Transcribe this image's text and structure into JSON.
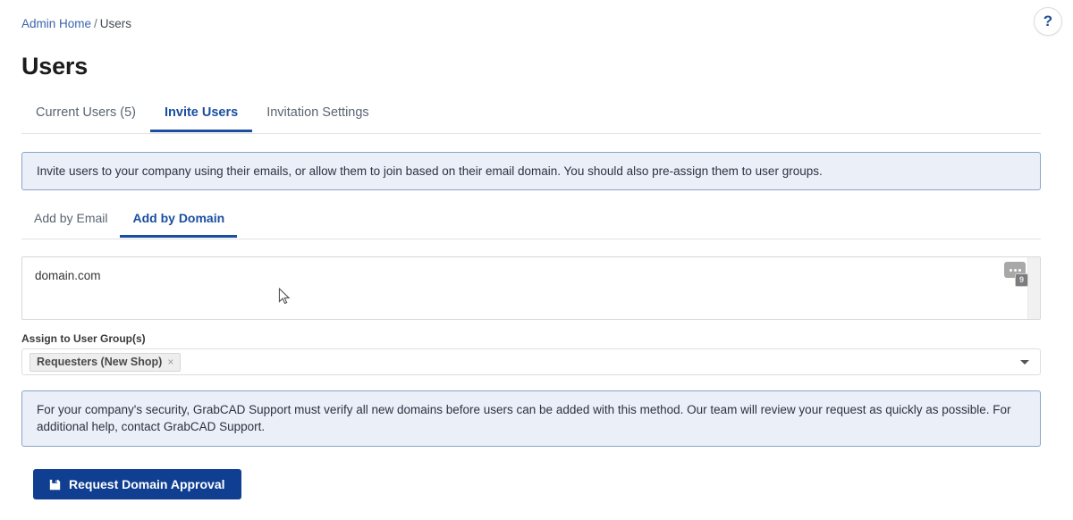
{
  "breadcrumb": {
    "home_label": "Admin Home",
    "separator": "/",
    "current_label": "Users"
  },
  "help": {
    "icon": "question-mark-icon",
    "label": "?"
  },
  "header": {
    "title": "Users"
  },
  "tabs": [
    {
      "label": "Current Users (5)",
      "active": false
    },
    {
      "label": "Invite Users",
      "active": true
    },
    {
      "label": "Invitation Settings",
      "active": false
    }
  ],
  "banner_top": {
    "text": "Invite users to your company using their emails, or allow them to join based on their email domain. You should also pre-assign them to user groups."
  },
  "subtabs": [
    {
      "label": "Add by Email",
      "active": false
    },
    {
      "label": "Add by Domain",
      "active": true
    }
  ],
  "domain_input": {
    "value": "domain.com",
    "placeholder": "domain.com",
    "extension_badge": "browser-extension-icon",
    "extension_badge_glyph": "9"
  },
  "group_field": {
    "label": "Assign to User Group(s)",
    "chips": [
      {
        "label": "Requesters (New Shop)",
        "remove": "×"
      }
    ],
    "caret_icon": "chevron-down-icon"
  },
  "banner_bottom": {
    "text": "For your company's security, GrabCAD Support must verify all new domains before users can be added with this method. Our team will review your request as quickly as possible. For additional help, contact GrabCAD Support."
  },
  "submit_button": {
    "label": "Request Domain Approval",
    "icon": "save-icon"
  },
  "colors": {
    "accent_blue": "#1a4fa0",
    "link_blue": "#3a63ad",
    "button_blue": "#103f91",
    "banner_bg": "#eaeff8",
    "banner_border": "#8ba4cc",
    "text_muted": "#5a6572"
  }
}
